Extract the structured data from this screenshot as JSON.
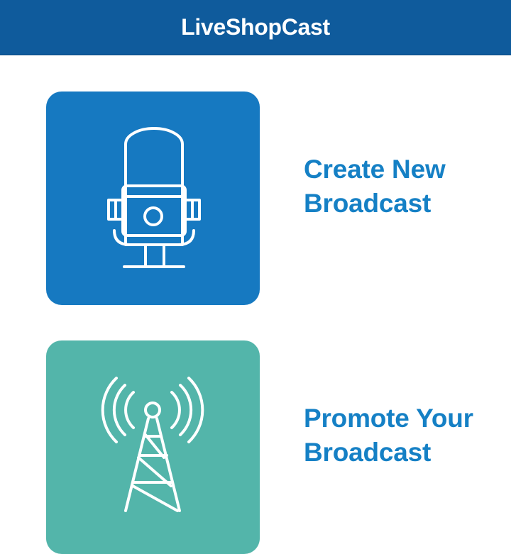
{
  "app": {
    "title": "LiveShopCast"
  },
  "menu": {
    "items": [
      {
        "id": "create-broadcast",
        "label_line1": "Create New",
        "label_line2": "Broadcast",
        "icon": "microphone-icon",
        "tile_color": "#1679c1"
      },
      {
        "id": "promote-broadcast",
        "label_line1": "Promote Your",
        "label_line2": "Broadcast",
        "icon": "broadcast-tower-icon",
        "tile_color": "#53b5aa"
      }
    ]
  },
  "colors": {
    "header": "#0f5b9c",
    "label_text": "#1580c5"
  }
}
